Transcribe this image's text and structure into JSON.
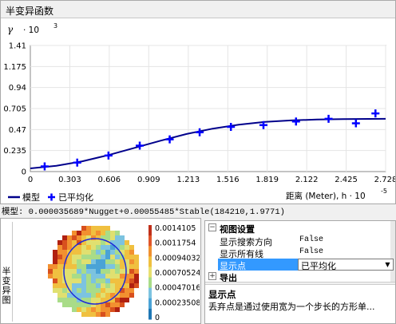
{
  "panel": {
    "title": "半变异函数"
  },
  "chart_data": {
    "type": "scatter",
    "y_axis_symbol": "γ",
    "y_axis_multiplier": "· 10",
    "y_axis_exponent": "3",
    "x_axis_label": "距离 (Meter), h · 10",
    "x_axis_exponent": "-5",
    "y_ticks": [
      "0",
      "0.235",
      "0.47",
      "0.705",
      "0.94",
      "1.175",
      "1.41"
    ],
    "x_ticks": [
      "0",
      "0.303",
      "0.606",
      "0.909",
      "1.213",
      "1.516",
      "1.819",
      "2.122",
      "2.425",
      "2.728"
    ],
    "xlim": [
      0,
      2.728
    ],
    "ylim": [
      0,
      1.41
    ],
    "series": [
      {
        "name": "模型",
        "type": "line",
        "color": "#00008b",
        "x": [
          0,
          0.2,
          0.4,
          0.6,
          0.8,
          1.0,
          1.2,
          1.4,
          1.6,
          1.8,
          2.0,
          2.2,
          2.4,
          2.6,
          2.728
        ],
        "values": [
          0.036,
          0.065,
          0.115,
          0.185,
          0.265,
          0.345,
          0.42,
          0.48,
          0.525,
          0.555,
          0.572,
          0.582,
          0.587,
          0.589,
          0.59
        ]
      },
      {
        "name": "已平均化",
        "type": "scatter",
        "color": "#0000ff",
        "x": [
          0.11,
          0.36,
          0.6,
          0.84,
          1.07,
          1.3,
          1.54,
          1.79,
          2.04,
          2.29,
          2.5,
          2.65
        ],
        "values": [
          0.058,
          0.1,
          0.18,
          0.29,
          0.36,
          0.44,
          0.5,
          0.52,
          0.56,
          0.59,
          0.54,
          0.65
        ]
      }
    ]
  },
  "legend": {
    "model_label": "模型",
    "averaged_label": "已平均化"
  },
  "model_text": "模型: 0.000035689*Nugget+0.00055485*Stable(184210,1.9771)",
  "surface_panel": {
    "vertical_label": "半变异图",
    "colorbar_labels": [
      "0.0014105",
      "0.0011754",
      "0.00094032",
      "0.00070524",
      "0.00047016",
      "0.00023508",
      "0"
    ]
  },
  "properties": {
    "view_settings_label": "视图设置",
    "rows": [
      {
        "name": "显示搜索方向",
        "value": "False"
      },
      {
        "name": "显示所有线",
        "value": "False"
      },
      {
        "name": "显示点",
        "value": "已平均化"
      }
    ],
    "export_label": "导出",
    "help_title": "显示点",
    "help_text": "丢弃点是通过使用宽为一个步长的方形单..."
  }
}
